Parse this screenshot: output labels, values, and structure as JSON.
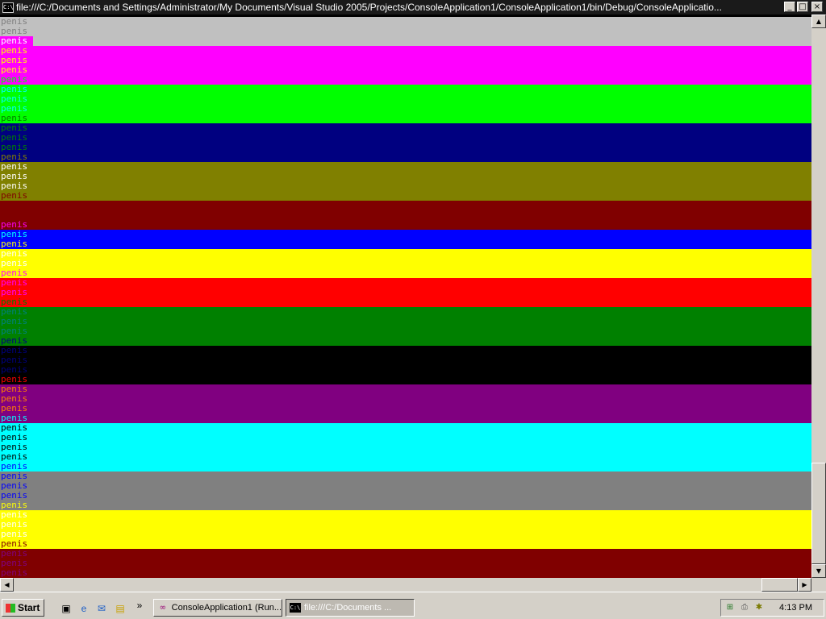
{
  "window": {
    "title": "file:///C:/Documents and Settings/Administrator/My Documents/Visual Studio 2005/Projects/ConsoleApplication1/ConsoleApplication1/bin/Debug/ConsoleApplicatio...",
    "title_icon": "console-icon",
    "buttons": {
      "minimize": "_",
      "maximize": "□",
      "close": "×"
    }
  },
  "console": {
    "word": "penis",
    "bands": [
      {
        "bg": "#c0c0c0",
        "fg": [
          "#808080",
          "#808080",
          "#ffffff"
        ],
        "line_bg": "#ff00ff"
      },
      {
        "bg": "#ff00ff",
        "fg": [
          "#ffff00",
          "#ffff00",
          "#ffff00",
          "#00ff00"
        ]
      },
      {
        "bg": "#00ff00",
        "fg": [
          "#00ffff",
          "#00ffff",
          "#00ffff",
          "#008000"
        ]
      },
      {
        "bg": "#000080",
        "fg": [
          "#008000",
          "#008000",
          "#008000",
          "#808000"
        ]
      },
      {
        "bg": "#808000",
        "fg": [
          "#ffffff",
          "#ffffff",
          "#ffffff",
          "#800000"
        ]
      },
      {
        "bg": "#800000",
        "fg": [
          "#800000",
          "#800000",
          "#ff00ff"
        ]
      },
      {
        "bg": "#0000ff",
        "fg": [
          "#00ffff",
          "#ffff00"
        ]
      },
      {
        "bg": "#ffff00",
        "fg": [
          "#ffffff",
          "#ffffff",
          "#ff00ff"
        ]
      },
      {
        "bg": "#ff0000",
        "fg": [
          "#ff00ff",
          "#ff00ff",
          "#008000"
        ]
      },
      {
        "bg": "#008000",
        "fg": [
          "#008080",
          "#008080",
          "#008080",
          "#000080"
        ]
      },
      {
        "bg": "#000000",
        "fg": [
          "#000080",
          "#000080",
          "#000080",
          "#ff0000"
        ]
      },
      {
        "bg": "#800080",
        "fg": [
          "#ff8000",
          "#ff8000",
          "#ff8000",
          "#00ffff"
        ]
      },
      {
        "bg": "#00ffff",
        "fg": [
          "#000000",
          "#000000",
          "#000000",
          "#000000",
          "#0000ff"
        ]
      },
      {
        "bg": "#808080",
        "fg": [
          "#0000ff",
          "#0000ff",
          "#0000ff",
          "#ffff00"
        ]
      },
      {
        "bg": "#ffff00",
        "fg": [
          "#ffffff",
          "#ffffff",
          "#ffffff",
          "#800000"
        ]
      },
      {
        "bg": "#800000",
        "fg": [
          "#800080",
          "#800080",
          "#800080"
        ]
      }
    ]
  },
  "taskbar": {
    "start_label": "Start",
    "quick_launch": [
      "show-desktop-icon",
      "internet-explorer-icon",
      "outlook-icon",
      "windows-explorer-icon"
    ],
    "more_label": "»",
    "tasks": [
      {
        "label": "ConsoleApplication1 (Run...",
        "icon": "visual-studio-icon",
        "active": false
      },
      {
        "label": "file:///C:/Documents ...",
        "icon": "console-icon",
        "active": true
      }
    ],
    "tray_icons": [
      "network-icon",
      "printer-icon",
      "bug-icon"
    ],
    "clock": "4:13 PM"
  }
}
